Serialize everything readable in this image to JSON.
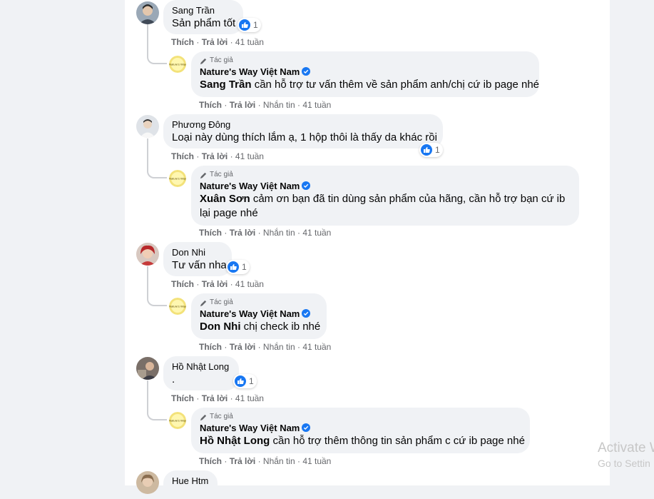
{
  "common": {
    "like": "Thích",
    "reply": "Trả lời",
    "message": "Nhắn tin",
    "time": "41 tuần",
    "author_label": "Tác giả",
    "page_name": "Nature's Way Việt Nam",
    "page_logo_text": "Nature's Way",
    "sep": "·"
  },
  "comments": [
    {
      "user": "Sang Trần",
      "text": "Sản phẩm tốt",
      "reactions": "1",
      "reply": {
        "mention": "Sang Trần",
        "text": " cần hỗ trợ tư vấn thêm về sản phẩm anh/chị cứ ib page nhé"
      }
    },
    {
      "user": "Phương Đông",
      "text": "Loại này dùng thích lắm ạ, 1 hộp thôi là thấy da khác rồi",
      "reactions": "1",
      "reply": {
        "mention": "Xuân Sơn",
        "text": " cảm ơn bạn đã tin dùng sản phẩm của hãng, cần hỗ trợ bạn cứ ib lại page nhé"
      }
    },
    {
      "user": "Don Nhi",
      "text": "Tư vấn nha",
      "reactions": "1",
      "reply": {
        "mention": "Don Nhi",
        "text": " chị check ib nhé"
      }
    },
    {
      "user": "Hồ Nhật Long",
      "text": ".",
      "reactions": "1",
      "reply": {
        "mention": "Hồ Nhật Long",
        "text": " cần hỗ trợ thêm thông tin sản phẩm c cứ ib page nhé"
      }
    },
    {
      "user": "Hue Htm"
    }
  ],
  "watermark": {
    "line1": "Activate W",
    "line2": "Go to Settin"
  },
  "colors": {
    "verified": "#1877f2",
    "like": "#1877f2",
    "bubble": "#f0f2f5",
    "meta": "#65676b"
  }
}
